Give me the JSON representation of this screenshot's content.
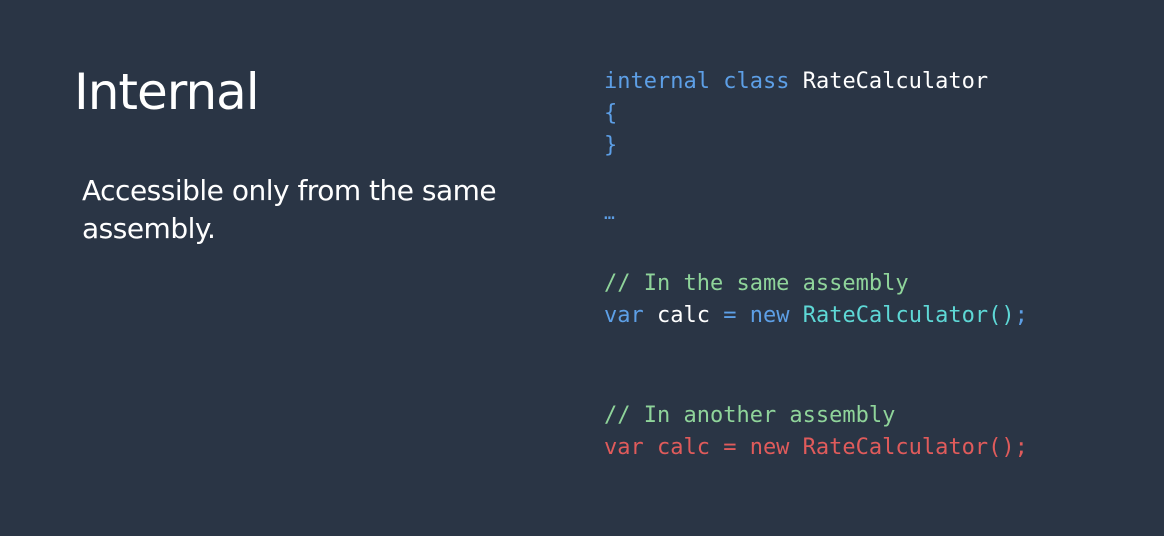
{
  "slide": {
    "title": "Internal",
    "description": "Accessible only from the same assembly."
  },
  "code": {
    "class_decl": {
      "keyword_internal": "internal",
      "keyword_class": "class",
      "class_name": "RateCalculator"
    },
    "open_brace": "{",
    "close_brace": "}",
    "ellipsis": "…",
    "same_assembly": {
      "comment": "// In the same assembly",
      "keyword_var": "var",
      "var_name": "calc",
      "equals": "=",
      "keyword_new": "new",
      "constructor_call": "RateCalculator()",
      "semicolon": ";"
    },
    "another_assembly": {
      "comment": "// In another assembly",
      "statement": "var calc = new RateCalculator();"
    }
  },
  "colors": {
    "background": "#2a3545",
    "keyword": "#5d9fe6",
    "type": "#5ed8d6",
    "comment": "#8fd49a",
    "error": "#e05b5b",
    "text": "#ffffff"
  }
}
